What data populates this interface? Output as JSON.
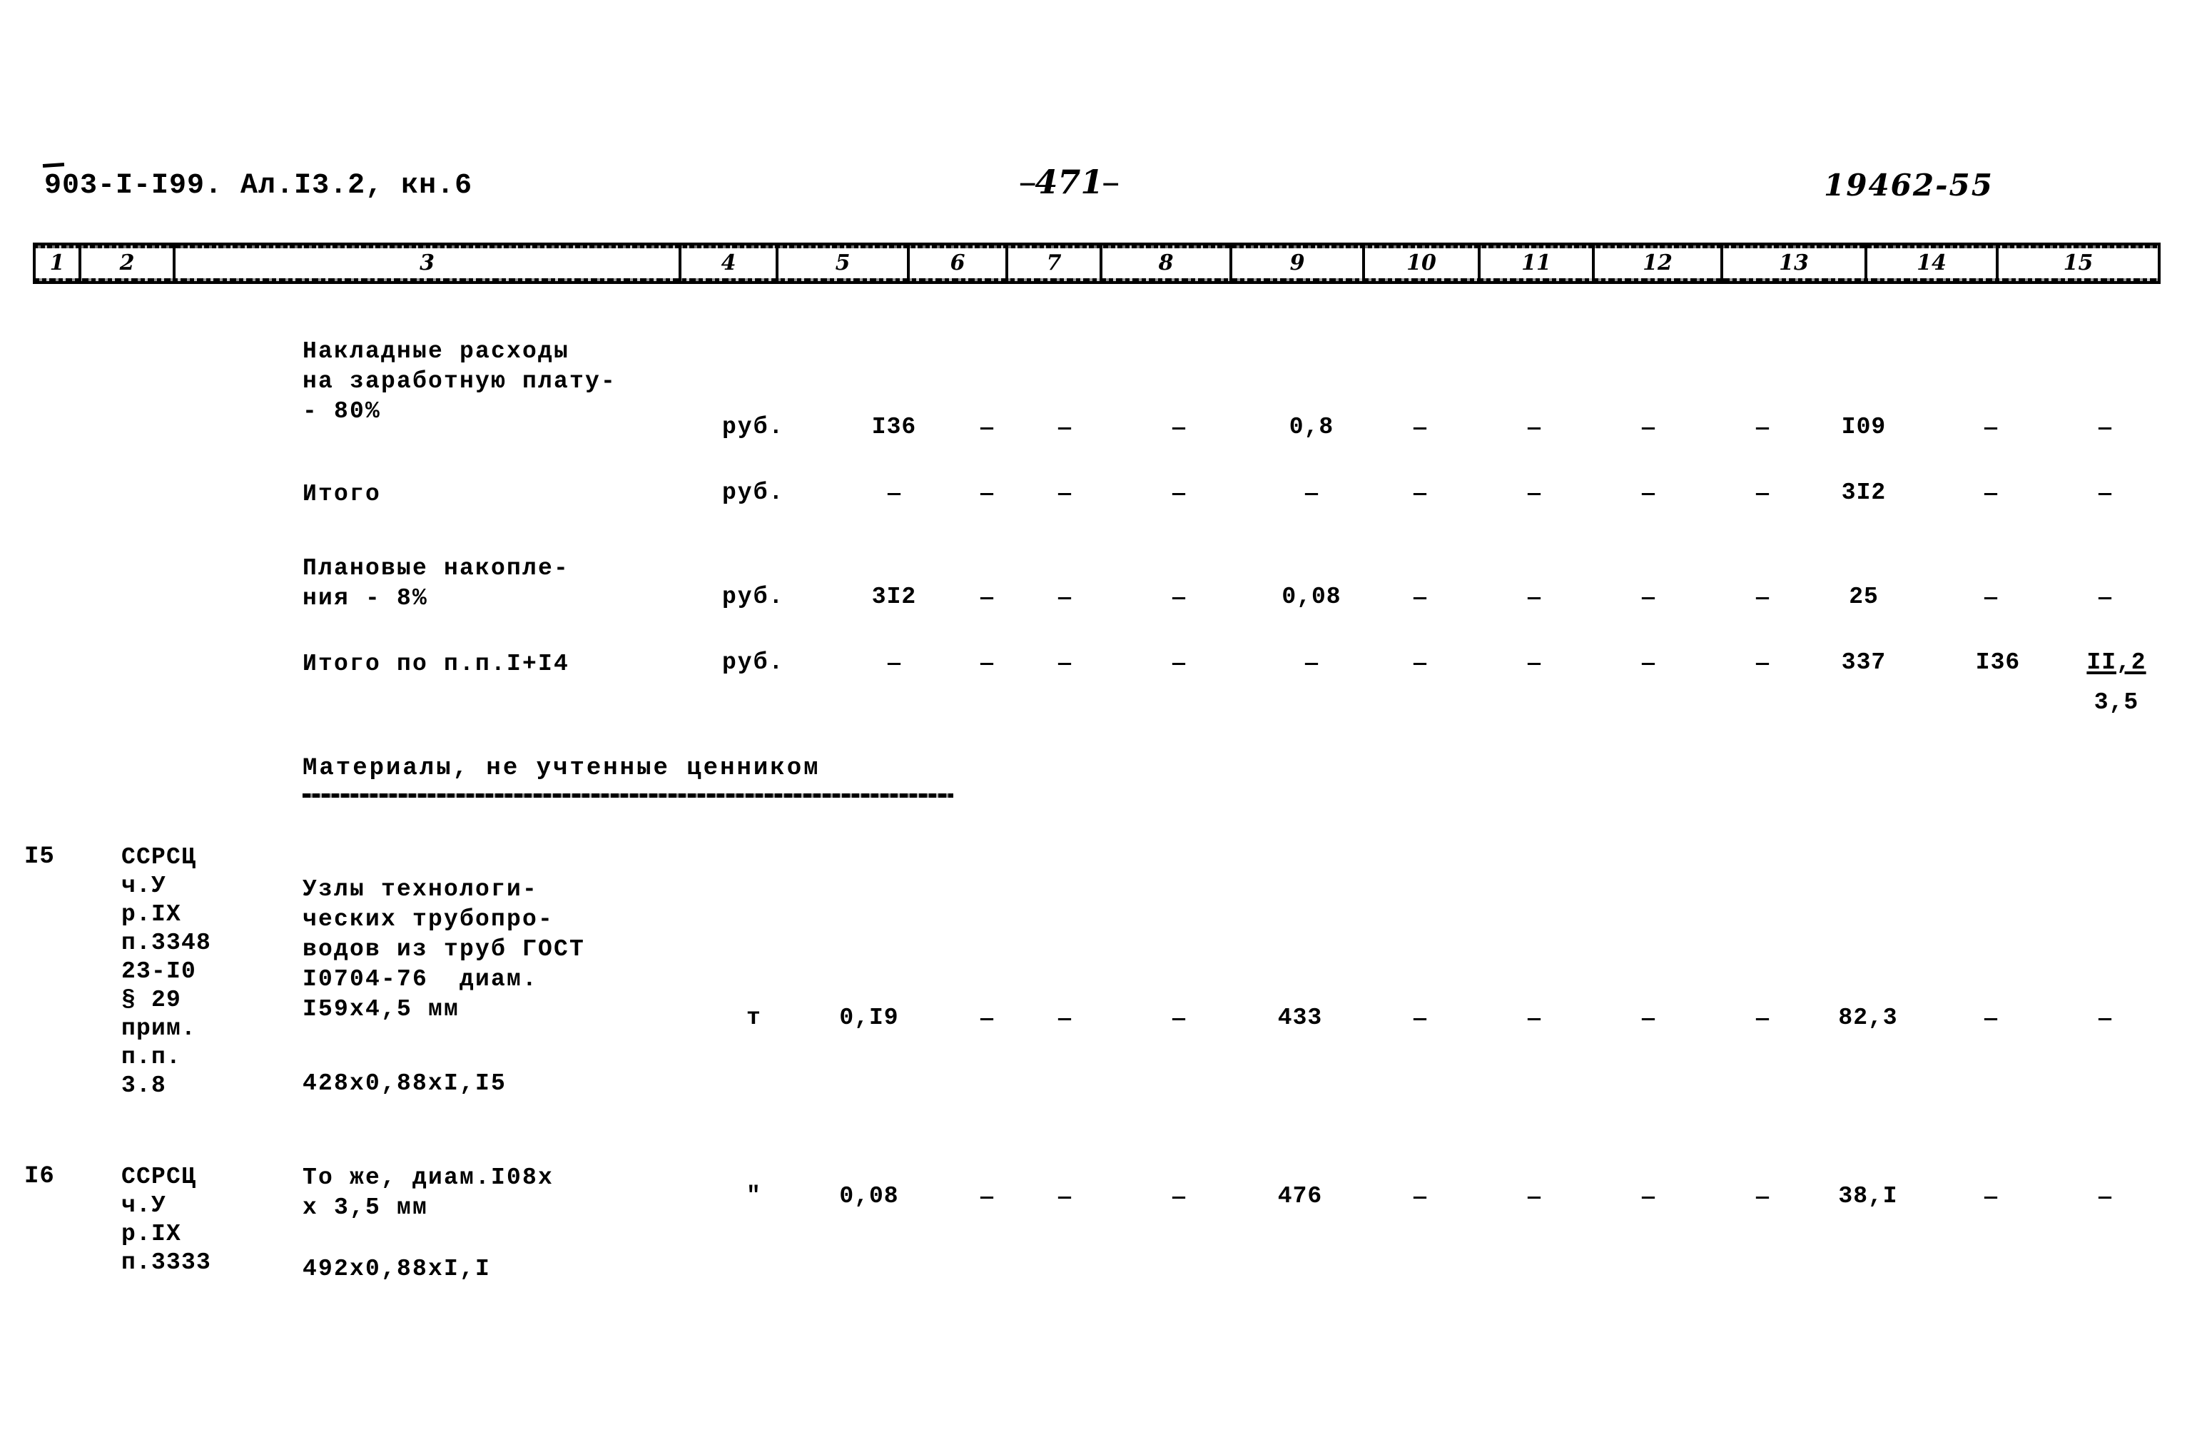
{
  "header": {
    "doc_code_prefix": "9",
    "doc_code": "03-I-I99. Ал.I3.2, кн.6",
    "page_number": "471",
    "dash_left": "—",
    "dash_right": "—",
    "stamp_number": "19462-55"
  },
  "column_ruler": {
    "labels": [
      "1",
      "2",
      "3",
      "4",
      "5",
      "6",
      "7",
      "8",
      "9",
      "10",
      "11",
      "12",
      "13",
      "14",
      "15"
    ]
  },
  "section": {
    "materials_heading": "Материалы, не учтенные ценником"
  },
  "dash": "—",
  "rows": [
    {
      "no": "",
      "code": "",
      "description": "Накладные расходы\nна заработную плату-\n- 80%",
      "unit": "руб.",
      "c5": "I36",
      "c6": "—",
      "c7": "—",
      "c8_dash": "—",
      "c8": "0,8",
      "c9": "—",
      "c10": "—",
      "c11": "—",
      "c12": "—",
      "c13": "I09",
      "c14": "—",
      "c15": "—"
    },
    {
      "no": "",
      "code": "",
      "description": "Итого",
      "unit": "руб.",
      "c5": "—",
      "c6": "—",
      "c7": "—",
      "c8_dash": "—",
      "c8": "—",
      "c9": "—",
      "c10": "—",
      "c11": "—",
      "c12": "—",
      "c13": "3I2",
      "c14": "—",
      "c15": "—"
    },
    {
      "no": "",
      "code": "",
      "description": "Плановые накопле-\nния - 8%",
      "unit": "руб.",
      "c5": "3I2",
      "c6": "—",
      "c7": "—",
      "c8_dash": "—",
      "c8": "0,08",
      "c9": "—",
      "c10": "—",
      "c11": "—",
      "c12": "—",
      "c13": "25",
      "c14": "—",
      "c15": "—"
    },
    {
      "no": "",
      "code": "",
      "description": "Итого по п.п.I+I4",
      "unit": "руб.",
      "c5": "—",
      "c6": "—",
      "c7": "—",
      "c8_dash": "—",
      "c8": "—",
      "c9": "—",
      "c10": "—",
      "c11": "—",
      "c12": "—",
      "c13": "337",
      "c14": "I36",
      "c15": "II,2",
      "c15_second": "3,5"
    },
    {
      "no": "I5",
      "code": "ССРСЦ\nч.У\nр.IХ\nп.3348\n23-I0\n§ 29\nприм.\nп.п.\n3.8",
      "description": "Узлы технологи-\nческих трубопро-\nводов из труб ГОСТ\nI0704-76  диам.\nI59x4,5 мм",
      "description2": "428x0,88xI,I5",
      "unit": "т",
      "c5": "0,I9",
      "c6": "—",
      "c7": "—",
      "c8_dash": "—",
      "c8": "433",
      "c9": "—",
      "c10": "—",
      "c11": "—",
      "c12": "—",
      "c13": "82,3",
      "c14": "—",
      "c15": "—"
    },
    {
      "no": "I6",
      "code": "ССРСЦ\nч.У\nр.IХ\nп.3333",
      "description": "То же, диам.I08x\nx 3,5 мм",
      "description2": "492x0,88xI,I",
      "unit": "\"",
      "c5": "0,08",
      "c6": "—",
      "c7": "—",
      "c8_dash": "—",
      "c8": "476",
      "c9": "—",
      "c10": "—",
      "c11": "—",
      "c12": "—",
      "c13": "38,I",
      "c14": "—",
      "c15": "—"
    }
  ]
}
